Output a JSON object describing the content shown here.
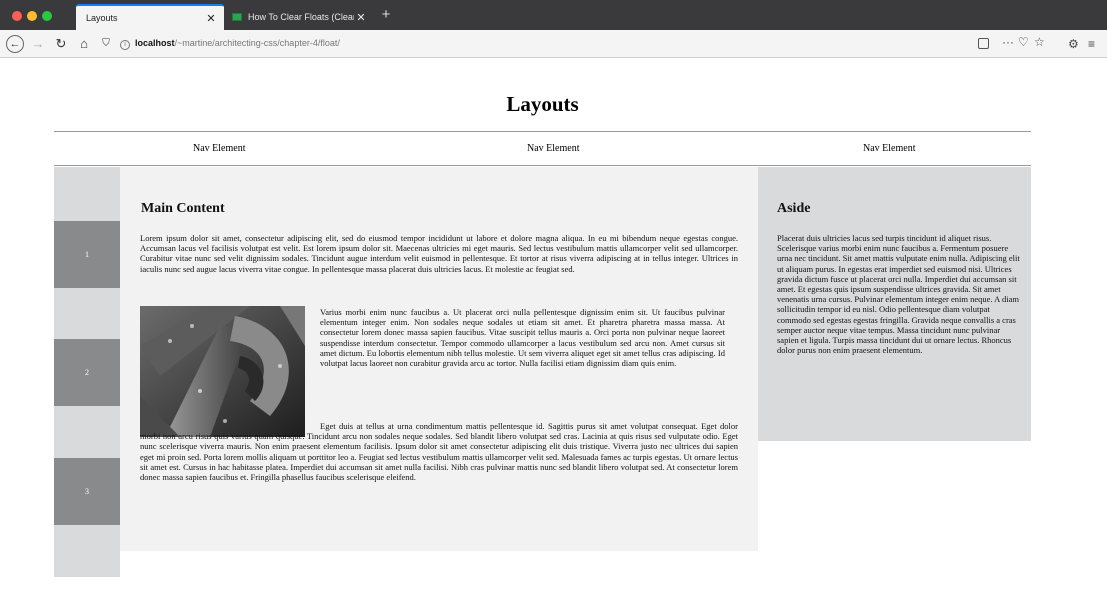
{
  "browser": {
    "tabs": [
      {
        "label": "Layouts",
        "active": true
      },
      {
        "label": "How To Clear Floats (Clearfix)",
        "active": false
      }
    ],
    "url_host": "localhost",
    "url_path": "/~martine/architecting-css/chapter-4/float/"
  },
  "page": {
    "title": "Layouts",
    "nav": [
      "Nav Element",
      "Nav Element",
      "Nav Element"
    ],
    "sidebar_boxes": [
      "1",
      "2",
      "3"
    ],
    "main": {
      "heading": "Main Content",
      "p1": "Lorem ipsum dolor sit amet, consectetur adipiscing elit, sed do eiusmod tempor incididunt ut labore et dolore magna aliqua. In eu mi bibendum neque egestas congue. Accumsan lacus vel facilisis volutpat est velit. Est lorem ipsum dolor sit. Maecenas ultricies mi eget mauris. Sed lectus vestibulum mattis ullamcorper velit sed ullamcorper. Curabitur vitae nunc sed velit dignissim sodales. Tincidunt augue interdum velit euismod in pellentesque. Et tortor at risus viverra adipiscing at in tellus integer. Ultrices in iaculis nunc sed augue lacus viverra vitae congue. In pellentesque massa placerat duis ultricies lacus. Et molestie ac feugiat sed.",
      "p2": "Varius morbi enim nunc faucibus a. Ut placerat orci nulla pellentesque dignissim enim sit. Ut faucibus pulvinar elementum integer enim. Non sodales neque sodales ut etiam sit amet. Et pharetra pharetra massa massa. At consectetur lorem donec massa sapien faucibus. Vitae suscipit tellus mauris a. Orci porta non pulvinar neque laoreet suspendisse interdum consectetur. Tempor commodo ullamcorper a lacus vestibulum sed arcu non. Amet cursus sit amet dictum. Eu lobortis elementum nibh tellus molestie. Ut sem viverra aliquet eget sit amet tellus cras adipiscing. Id volutpat lacus laoreet non curabitur gravida arcu ac tortor. Nulla facilisi etiam dignissim diam quis enim.",
      "p3": "Eget duis at tellus at urna condimentum mattis pellentesque id. Sagittis purus sit amet volutpat consequat. Eget dolor morbi non arcu risus quis varius quam quisque. Tincidunt arcu non sodales neque sodales. Sed blandit libero volutpat sed cras. Lacinia at quis risus sed vulputate odio. Eget nunc scelerisque viverra mauris. Non enim praesent elementum facilisis. Ipsum dolor sit amet consectetur adipiscing elit duis tristique. Viverra justo nec ultrices dui sapien eget mi proin sed. Porta lorem mollis aliquam ut porttitor leo a. Feugiat sed lectus vestibulum mattis ullamcorper velit sed. Malesuada fames ac turpis egestas. Ut ornare lectus sit amet est. Cursus in hac habitasse platea. Imperdiet dui accumsan sit amet nulla facilisi. Nibh cras pulvinar mattis nunc sed blandit libero volutpat sed. At consectetur lorem donec massa sapien faucibus et. Fringilla phasellus faucibus scelerisque eleifend."
    },
    "aside": {
      "heading": "Aside",
      "text": "Placerat duis ultricies lacus sed turpis tincidunt id aliquet risus. Scelerisque varius morbi enim nunc faucibus a. Fermentum posuere urna nec tincidunt. Sit amet mattis vulputate enim nulla. Adipiscing elit ut aliquam purus. In egestas erat imperdiet sed euismod nisi. Ultrices gravida dictum fusce ut placerat orci nulla. Imperdiet dui accumsan sit amet. Et egestas quis ipsum suspendisse ultrices gravida. Sit amet venenatis urna cursus. Pulvinar elementum integer enim neque. A diam sollicitudin tempor id eu nisl. Odio pellentesque diam volutpat commodo sed egestas egestas fringilla. Gravida neque convallis a cras semper auctor neque vitae tempus. Massa tincidunt nunc pulvinar sapien et ligula. Turpis massa tincidunt dui ut ornare lectus. Rhoncus dolor purus non enim praesent elementum."
    }
  }
}
